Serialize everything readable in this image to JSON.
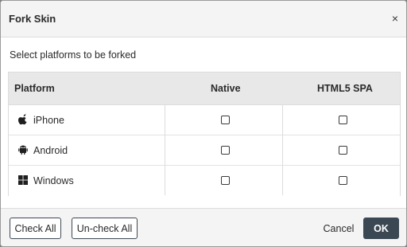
{
  "dialog": {
    "title": "Fork Skin",
    "close_glyph": "×",
    "subtitle": "Select platforms to be forked"
  },
  "table": {
    "headers": [
      "Platform",
      "Native",
      "HTML5 SPA"
    ],
    "rows": [
      {
        "platform": "iPhone",
        "icon": "apple-icon",
        "native": false,
        "html5_spa": false
      },
      {
        "platform": "Android",
        "icon": "android-icon",
        "native": false,
        "html5_spa": false
      },
      {
        "platform": "Windows",
        "icon": "windows-icon",
        "native": false,
        "html5_spa": false
      }
    ]
  },
  "footer": {
    "check_all": "Check All",
    "uncheck_all": "Un-check All",
    "cancel": "Cancel",
    "ok": "OK"
  }
}
